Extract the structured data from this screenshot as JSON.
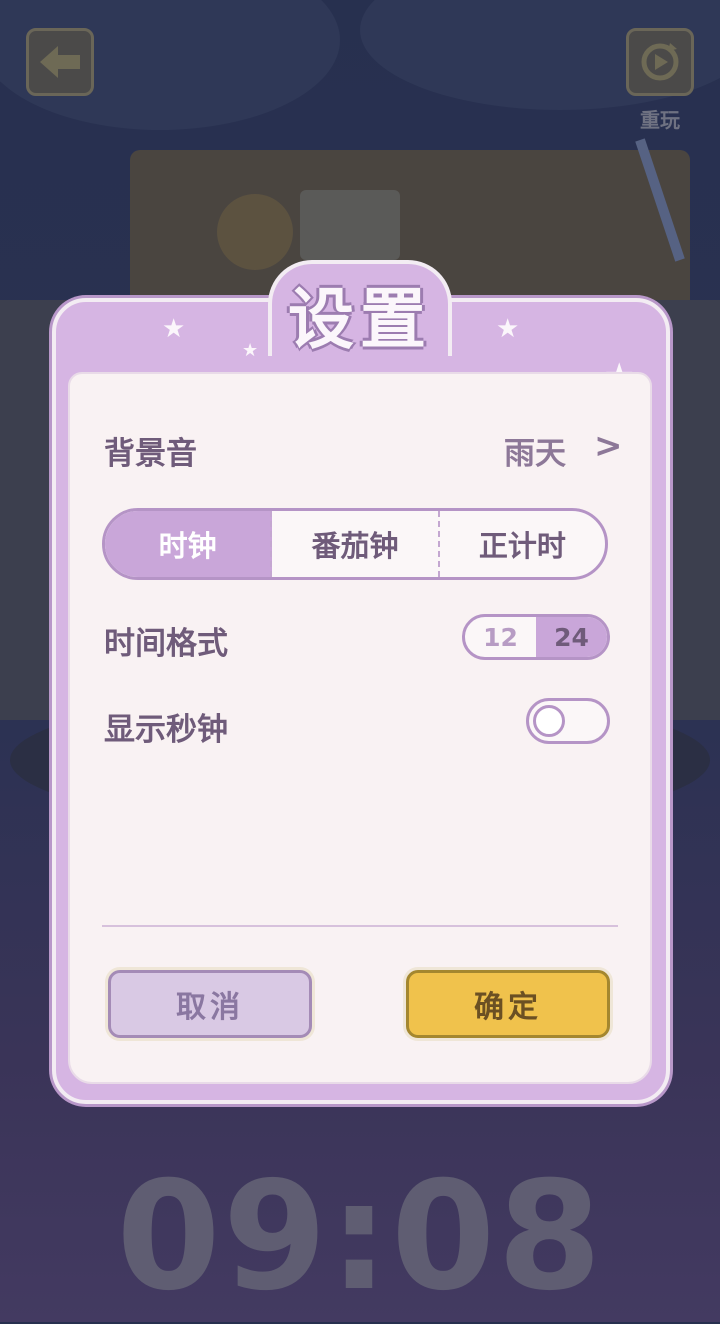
{
  "header": {
    "replay_label": "重玩"
  },
  "settings": {
    "title": "设置",
    "background_sound": {
      "label": "背景音",
      "value": "雨天",
      "chevron": ">"
    },
    "mode_tabs": [
      "时钟",
      "番茄钟",
      "正计时"
    ],
    "mode_selected": "时钟",
    "time_format": {
      "label": "时间格式",
      "options": [
        "12",
        "24"
      ],
      "selected": "24"
    },
    "show_seconds": {
      "label": "显示秒钟",
      "enabled": false
    },
    "cancel_label": "取消",
    "confirm_label": "确定"
  },
  "clock": {
    "time": "09:08"
  },
  "colors": {
    "panel_purple": "#d6b5e3",
    "accent_purple": "#b594c6",
    "confirm_yellow": "#f0c24c"
  },
  "icons": [
    "back-arrow-icon",
    "replay-icon",
    "chevron-right-icon"
  ]
}
